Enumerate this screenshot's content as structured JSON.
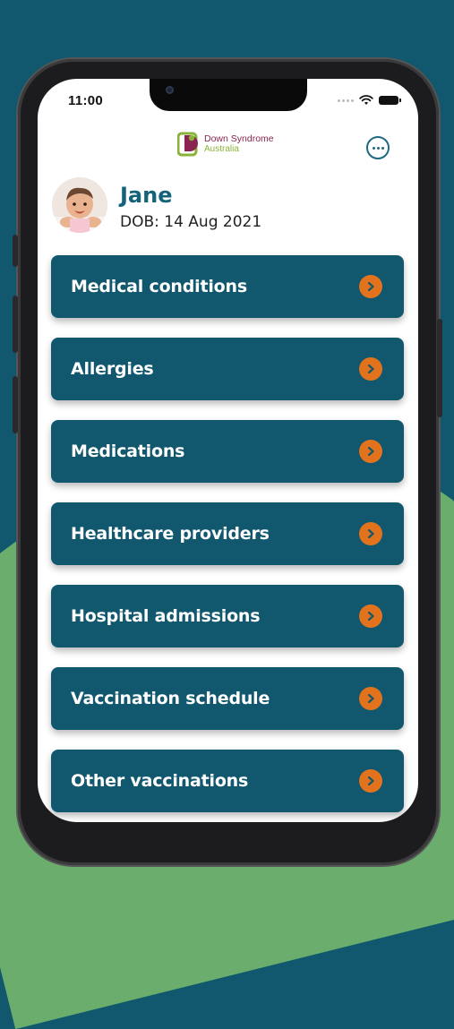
{
  "status_bar": {
    "time": "11:00"
  },
  "header": {
    "logo_name": "Down Syndrome",
    "logo_sub": "Australia"
  },
  "profile": {
    "name": "Jane",
    "dob": "DOB: 14 Aug 2021"
  },
  "menu": {
    "items": [
      {
        "label": "Medical conditions"
      },
      {
        "label": "Allergies"
      },
      {
        "label": "Medications"
      },
      {
        "label": "Healthcare providers"
      },
      {
        "label": "Hospital admissions"
      },
      {
        "label": "Vaccination schedule"
      },
      {
        "label": "Other vaccinations"
      }
    ]
  },
  "colors": {
    "background": "#11586e",
    "accent_green": "#6aad6c",
    "card": "#11586e",
    "chevron": "#e2731c",
    "name_text": "#14637a",
    "logo_purple": "#8a2451",
    "logo_green": "#8bb33a"
  },
  "icons": {
    "menu": "more-icon",
    "chevron": "chevron-right-icon",
    "wifi": "wifi-icon",
    "battery": "battery-icon"
  }
}
